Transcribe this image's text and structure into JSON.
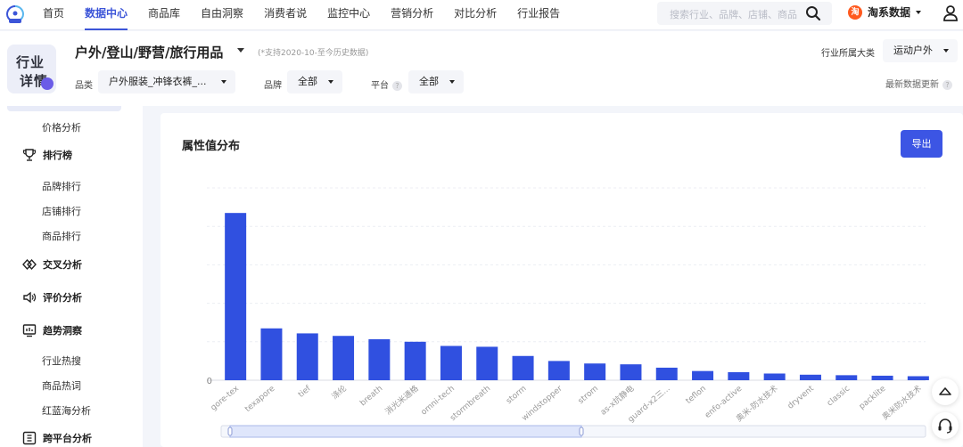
{
  "nav": {
    "items": [
      "首页",
      "数据中心",
      "商品库",
      "自由洞察",
      "消费者说",
      "监控中心",
      "营销分析",
      "对比分析",
      "行业报告"
    ],
    "active_index": 1,
    "search_placeholder": "搜索行业、品牌、店铺、商品",
    "brand_label": "淘系数据",
    "brand_badge": "淘"
  },
  "header": {
    "tile_line1": "行业",
    "tile_line2": "详情",
    "title": "户外/登山/野营/旅行用品",
    "note": "(*支持2020-10-至今历史数据)",
    "filters": {
      "category_label": "品类",
      "category_value": "户外服装_冲锋衣裤_...",
      "brand_label": "品牌",
      "brand_value": "全部",
      "platform_label": "平台",
      "platform_value": "全部"
    },
    "industry_label": "行业所属大类",
    "industry_value": "运动户外",
    "latest_update": "最新数据更新"
  },
  "sidebar": {
    "price": "价格分析",
    "ranking": "排行榜",
    "brand_rank": "品牌排行",
    "shop_rank": "店铺排行",
    "item_rank": "商品排行",
    "cross": "交叉分析",
    "review": "评价分析",
    "trend": "趋势洞察",
    "hot_search": "行业热搜",
    "hot_words": "商品热词",
    "red_blue": "红蓝海分析",
    "cross_platform": "跨平台分析"
  },
  "card": {
    "title": "属性值分布",
    "export": "导出"
  },
  "accent_color": "#3c55e4",
  "chart_data": {
    "type": "bar",
    "categories": [
      "gore-tex",
      "texapore",
      "tief",
      "涤纶",
      "breath",
      "消光米通格",
      "omni-tech",
      "stormbreath",
      "storm",
      "windstopper",
      "strom",
      "as-x抗静电",
      "guard-x2三...",
      "teflon",
      "enfo-active",
      "奥米-防水技术",
      "dryvent",
      "classic",
      "packlite",
      "奥米防水技术"
    ],
    "values": [
      100,
      31,
      28,
      26.5,
      24.5,
      23,
      20.5,
      20,
      14.5,
      11.5,
      10,
      9.5,
      7.5,
      5.5,
      4.8,
      4,
      3.3,
      3,
      2.7,
      2.4
    ],
    "y_tick_labels": [
      "0"
    ],
    "ylim": [
      0,
      115
    ],
    "grid": true,
    "bar_color": "#3050e0"
  }
}
